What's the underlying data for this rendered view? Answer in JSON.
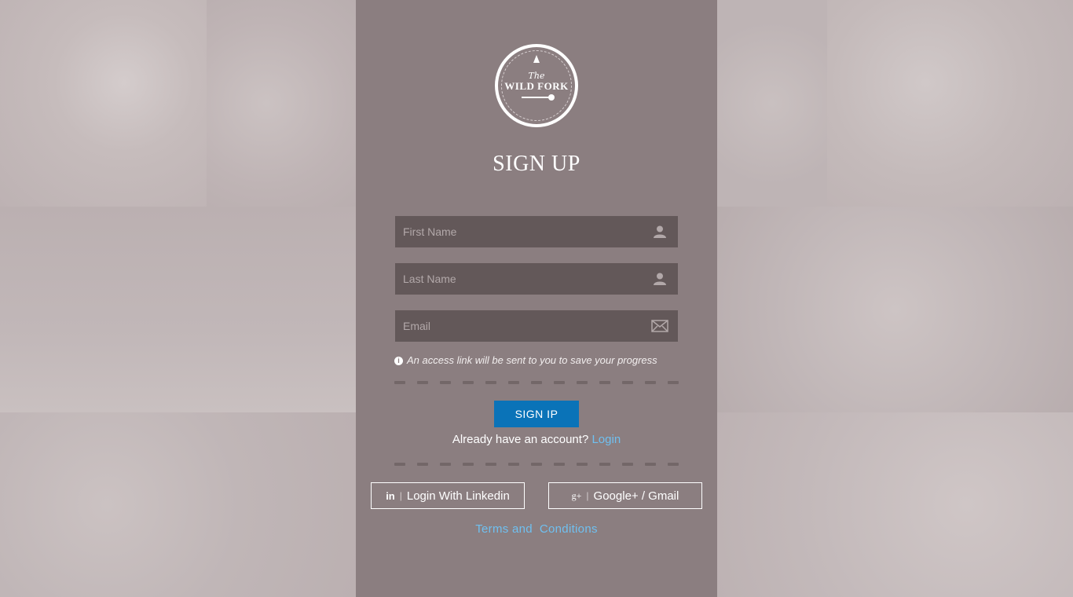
{
  "logo": {
    "the": "The",
    "name": "WILD FORK"
  },
  "form": {
    "title": "SIGN UP",
    "first_name_placeholder": "First Name",
    "last_name_placeholder": "Last Name",
    "email_placeholder": "Email",
    "hint": "An access link will be sent to you to save your progress",
    "submit_label": "SIGN IP",
    "already_text": "Already have an account?",
    "login_link": "Login"
  },
  "social": {
    "linkedin_icon": "in",
    "linkedin_label": "Login With Linkedin",
    "google_icon": "g+",
    "google_label": "Google+ / Gmail",
    "separator": "|"
  },
  "footer": {
    "terms_label": "Terms and  Conditions"
  },
  "colors": {
    "panel": "#8b7e80",
    "field": "#635859",
    "button": "#0a73b8",
    "link": "#6fc0f0"
  }
}
